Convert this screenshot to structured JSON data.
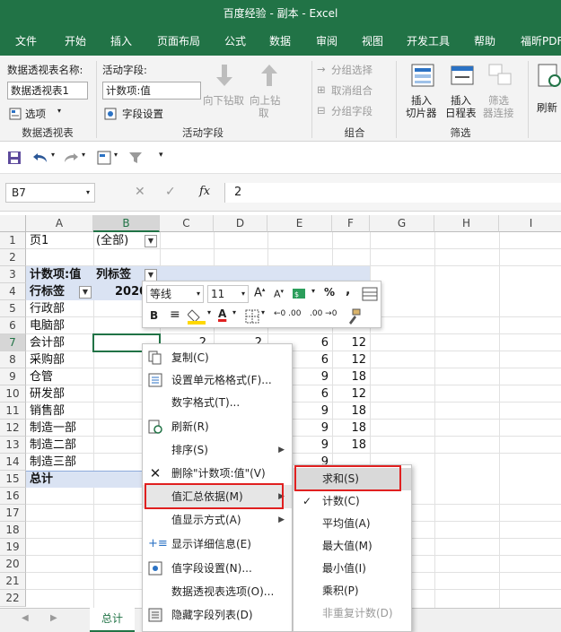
{
  "window": {
    "title": "百度经验 - 副本  -  Excel"
  },
  "tabs": [
    "文件",
    "开始",
    "插入",
    "页面布局",
    "公式",
    "数据",
    "审阅",
    "视图",
    "开发工具",
    "帮助",
    "福昕PDF"
  ],
  "ribbon": {
    "pivot_name_label": "数据透视表名称:",
    "pivot_name_value": "数据透视表1",
    "options_label": "选项",
    "group_pivot": "数据透视表",
    "active_field_label": "活动字段:",
    "active_field_value": "计数项:值",
    "field_settings": "字段设置",
    "drill_down": "向下钻取",
    "drill_up_1": "向上钻",
    "drill_up_2": "取",
    "group_active": "活动字段",
    "group_selection": "分组选择",
    "ungroup": "取消组合",
    "group_field": "分组字段",
    "group_group": "组合",
    "insert_slicer_1": "插入",
    "insert_slicer_2": "切片器",
    "insert_timeline_1": "插入",
    "insert_timeline_2": "日程表",
    "filter_conn_1": "筛选",
    "filter_conn_2": "器连接",
    "group_filter": "筛选",
    "refresh": "刷新"
  },
  "formula_bar": {
    "name_box": "B7",
    "value": "2",
    "fx": "fx"
  },
  "columns": [
    "A",
    "B",
    "C",
    "D",
    "E",
    "F",
    "G",
    "H",
    "I"
  ],
  "rows": [
    "1",
    "2",
    "3",
    "4",
    "5",
    "6",
    "7",
    "8",
    "9",
    "10",
    "11",
    "12",
    "13",
    "14",
    "15",
    "16",
    "17",
    "18",
    "19",
    "20",
    "21",
    "22"
  ],
  "cells": {
    "a1": "页1",
    "b1": "(全部)",
    "a3": "计数项:值",
    "b3": "列标签",
    "a4": "行标签",
    "b4": "2020",
    "a5": "行政部",
    "a6": "电脑部",
    "a7": "会计部",
    "a8": "采购部",
    "a9": "仓管",
    "a10": "研发部",
    "a11": "销售部",
    "a12": "制造一部",
    "a13": "制造二部",
    "a14": "制造三部",
    "a15": "总计",
    "c7": "2",
    "d7": "2",
    "e7": "6",
    "e8": "6",
    "e9": "9",
    "e10": "6",
    "e11": "9",
    "e12": "9",
    "e13": "9",
    "e14": "9",
    "f7": "12",
    "f8": "12",
    "f9": "18",
    "f10": "12",
    "f11": "18",
    "f12": "18",
    "f13": "18"
  },
  "mini_toolbar": {
    "font": "等线",
    "size": "11",
    "percent": "%",
    "comma": ","
  },
  "context_menu": {
    "copy": "复制(C)",
    "format_cells": "设置单元格格式(F)...",
    "number_format": "数字格式(T)...",
    "refresh": "刷新(R)",
    "sort": "排序(S)",
    "delete": "删除\"计数项:值\"(V)",
    "summarize": "值汇总依据(M)",
    "show_as": "值显示方式(A)",
    "show_details": "显示详细信息(E)",
    "field_settings": "值字段设置(N)...",
    "pivot_options": "数据透视表选项(O)...",
    "hide_field_list": "隐藏字段列表(D)"
  },
  "submenu": {
    "sum": "求和(S)",
    "count": "计数(C)",
    "average": "平均值(A)",
    "max": "最大值(M)",
    "min": "最小值(I)",
    "product": "乘积(P)",
    "distinct": "非重复计数(D)"
  },
  "sheet_tab": "总计",
  "colors": {
    "excel_green": "#217346",
    "highlight_red": "#e02020",
    "pivot_header": "#dae3f3"
  }
}
